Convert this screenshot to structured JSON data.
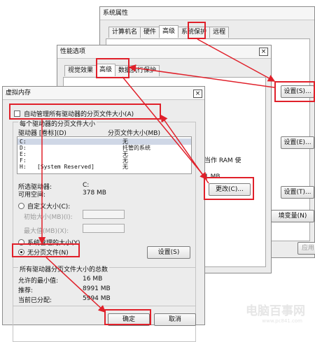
{
  "sys": {
    "title": "系统属性",
    "tabs": [
      "计算机名",
      "硬件",
      "高级",
      "系统保护",
      "远程"
    ],
    "settings_btns": [
      "设置(S)...",
      "设置(E)...",
      "设置(T)..."
    ],
    "env_btn": "境变量(N)",
    "apply_btn": "应用"
  },
  "perf": {
    "title": "性能选项",
    "close": "×",
    "tabs": [
      "视觉效果",
      "高级",
      "数据执行保护"
    ],
    "ram_text": "当作 RAM 使",
    "mb_text": "1 MB",
    "change_btn": "更改(C)..."
  },
  "vm": {
    "title": "虚拟内存",
    "close": "×",
    "auto_manage_label": "自动管理所有驱动器的分页文件大小(A)",
    "per_drive_label": "每个驱动器的分页文件大小",
    "col_drive": "驱动器 [卷标](D)",
    "col_size": "分页文件大小(MB)",
    "drives": [
      {
        "drive": "C:",
        "label": "",
        "size": "无"
      },
      {
        "drive": "D:",
        "label": "",
        "size": "托管的系统"
      },
      {
        "drive": "E:",
        "label": "",
        "size": "无"
      },
      {
        "drive": "F:",
        "label": "",
        "size": "无"
      },
      {
        "drive": "H:",
        "label": "[System Reserved]",
        "size": "无"
      }
    ],
    "selected_drive_label": "所选驱动器:",
    "selected_drive_value": "C:",
    "free_space_label": "可用空间:",
    "free_space_value": "378 MB",
    "custom_size_label": "自定义大小(C):",
    "initial_size_label": "初始大小(MB)(I):",
    "max_size_label": "最大值(MB)(X):",
    "system_managed_label": "系统管理的大小(Y)",
    "no_paging_label": "无分页文件(N)",
    "set_btn": "设置(S)",
    "total_title": "所有驱动器分页文件大小的总数",
    "min_label": "允许的最小值:",
    "min_value": "16 MB",
    "recommended_label": "推荐:",
    "recommended_value": "8991 MB",
    "allocated_label": "当前已分配:",
    "allocated_value": "5994 MB",
    "ok_btn": "确定",
    "cancel_btn": "取消"
  },
  "watermark": {
    "name": "电脑百事网",
    "url": "www.pc841.com"
  },
  "colors": {
    "highlight": "#e0202a"
  }
}
